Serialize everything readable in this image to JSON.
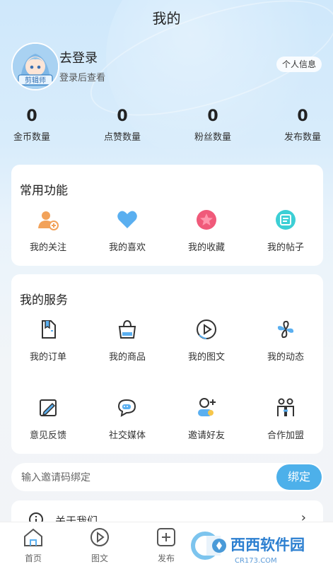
{
  "header": {
    "title": "我的"
  },
  "profile": {
    "login_label": "去登录",
    "login_hint": "登录后查看",
    "info_button": "个人信息",
    "avatar_caption": "剪辑师"
  },
  "stats": [
    {
      "value": "0",
      "label": "金币数量"
    },
    {
      "value": "0",
      "label": "点赞数量"
    },
    {
      "value": "0",
      "label": "粉丝数量"
    },
    {
      "value": "0",
      "label": "发布数量"
    }
  ],
  "common": {
    "title": "常用功能",
    "items": [
      {
        "label": "我的关注",
        "icon": "follow-icon"
      },
      {
        "label": "我的喜欢",
        "icon": "heart-icon"
      },
      {
        "label": "我的收藏",
        "icon": "star-icon"
      },
      {
        "label": "我的帖子",
        "icon": "post-icon"
      }
    ]
  },
  "services": {
    "title": "我的服务",
    "items": [
      {
        "label": "我的订单",
        "icon": "order-icon"
      },
      {
        "label": "我的商品",
        "icon": "bag-icon"
      },
      {
        "label": "我的图文",
        "icon": "play-icon"
      },
      {
        "label": "我的动态",
        "icon": "pinwheel-icon"
      },
      {
        "label": "意见反馈",
        "icon": "feedback-icon"
      },
      {
        "label": "社交媒体",
        "icon": "chat-icon"
      },
      {
        "label": "邀请好友",
        "icon": "invite-icon"
      },
      {
        "label": "合作加盟",
        "icon": "partner-icon"
      }
    ]
  },
  "invite": {
    "placeholder": "输入邀请码绑定",
    "bind_button": "绑定"
  },
  "about": {
    "label": "关于我们"
  },
  "tabs": [
    {
      "label": "首页",
      "icon": "home-icon"
    },
    {
      "label": "图文",
      "icon": "video-icon"
    },
    {
      "label": "发布",
      "icon": "plus-icon"
    }
  ],
  "watermark": {
    "text": "西西软件园",
    "url": "CR173.COM"
  },
  "colors": {
    "accent": "#4db0ea",
    "heart": "#5aaff0",
    "star": "#f05a7a",
    "follow": "#f2a25a",
    "post": "#3ccfd5"
  }
}
